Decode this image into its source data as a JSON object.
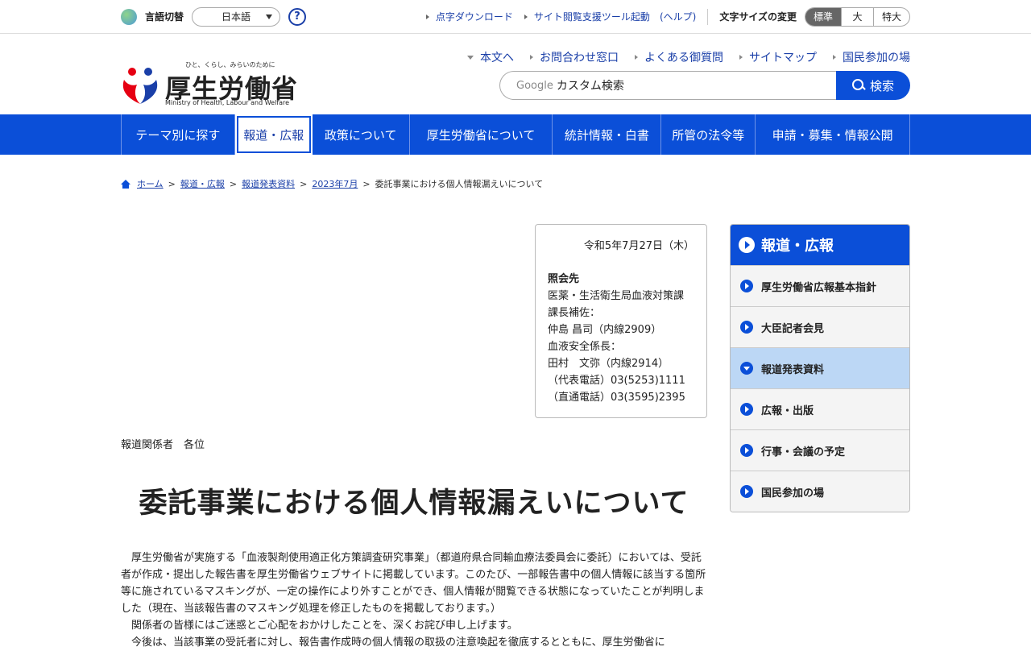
{
  "topbar": {
    "lang_label": "言語切替",
    "lang_value": "日本語",
    "help": "?",
    "links": [
      "点字ダウンロード",
      "サイト閲覧支援ツール起動"
    ],
    "help_link": "(ヘルプ)",
    "font_size_label": "文字サイズの変更",
    "font_sizes": [
      "標準",
      "大",
      "特大"
    ]
  },
  "header": {
    "logo_tagline": "ひと、くらし、みらいのために",
    "logo_name": "厚生労働省",
    "logo_en": "Ministry of Health, Labour and Welfare",
    "links": [
      "本文へ",
      "お問合わせ窓口",
      "よくある御質問",
      "サイトマップ",
      "国民参加の場"
    ],
    "search_google": "Google",
    "search_placeholder": "カスタム検索",
    "search_button": "検索"
  },
  "nav": [
    "テーマ別に探す",
    "報道・広報",
    "政策について",
    "厚生労働省について",
    "統計情報・白書",
    "所管の法令等",
    "申請・募集・情報公開"
  ],
  "breadcrumb": [
    "ホーム",
    "報道・広報",
    "報道発表資料",
    "2023年7月",
    "委託事業における個人情報漏えいについて"
  ],
  "contact": {
    "date": "令和5年7月27日（木）",
    "heading": "照会先",
    "lines": [
      "医薬・生活衛生局血液対策課",
      "課長補佐：",
      "仲島 昌司（内線2909）",
      "血液安全係長：",
      "田村　文弥（内線2914）",
      "（代表電話）03(5253)1111",
      "（直通電話）03(3595)2395"
    ]
  },
  "addressee": "報道関係者　各位",
  "title": "委託事業における個人情報漏えいについて",
  "body": [
    "厚生労働省が実施する「血液製剤使用適正化方策調査研究事業」（都道府県合同輸血療法委員会に委託）においては、受託者が作成・提出した報告書を厚生労働省ウェブサイトに掲載しています。このたび、一部報告書中の個人情報に該当する箇所等に施されているマスキングが、一定の操作により外すことができ、個人情報が閲覧できる状態になっていたことが判明しました（現在、当該報告書のマスキング処理を修正したものを掲載しております。）",
    "関係者の皆様にはご迷惑とご心配をおかけしたことを、深くお詫び申し上げます。",
    "今後は、当該事業の受託者に対し、報告書作成時の個人情報の取扱の注意喚起を徹底するとともに、厚生労働省に"
  ],
  "side": {
    "heading": "報道・広報",
    "items": [
      "厚生労働省広報基本指針",
      "大臣記者会見",
      "報道発表資料",
      "広報・出版",
      "行事・会議の予定",
      "国民参加の場"
    ],
    "active_index": 2
  },
  "colors": {
    "primary": "#0b4fd8",
    "link": "#1a3fa8",
    "active_side": "#bcd7f5"
  }
}
